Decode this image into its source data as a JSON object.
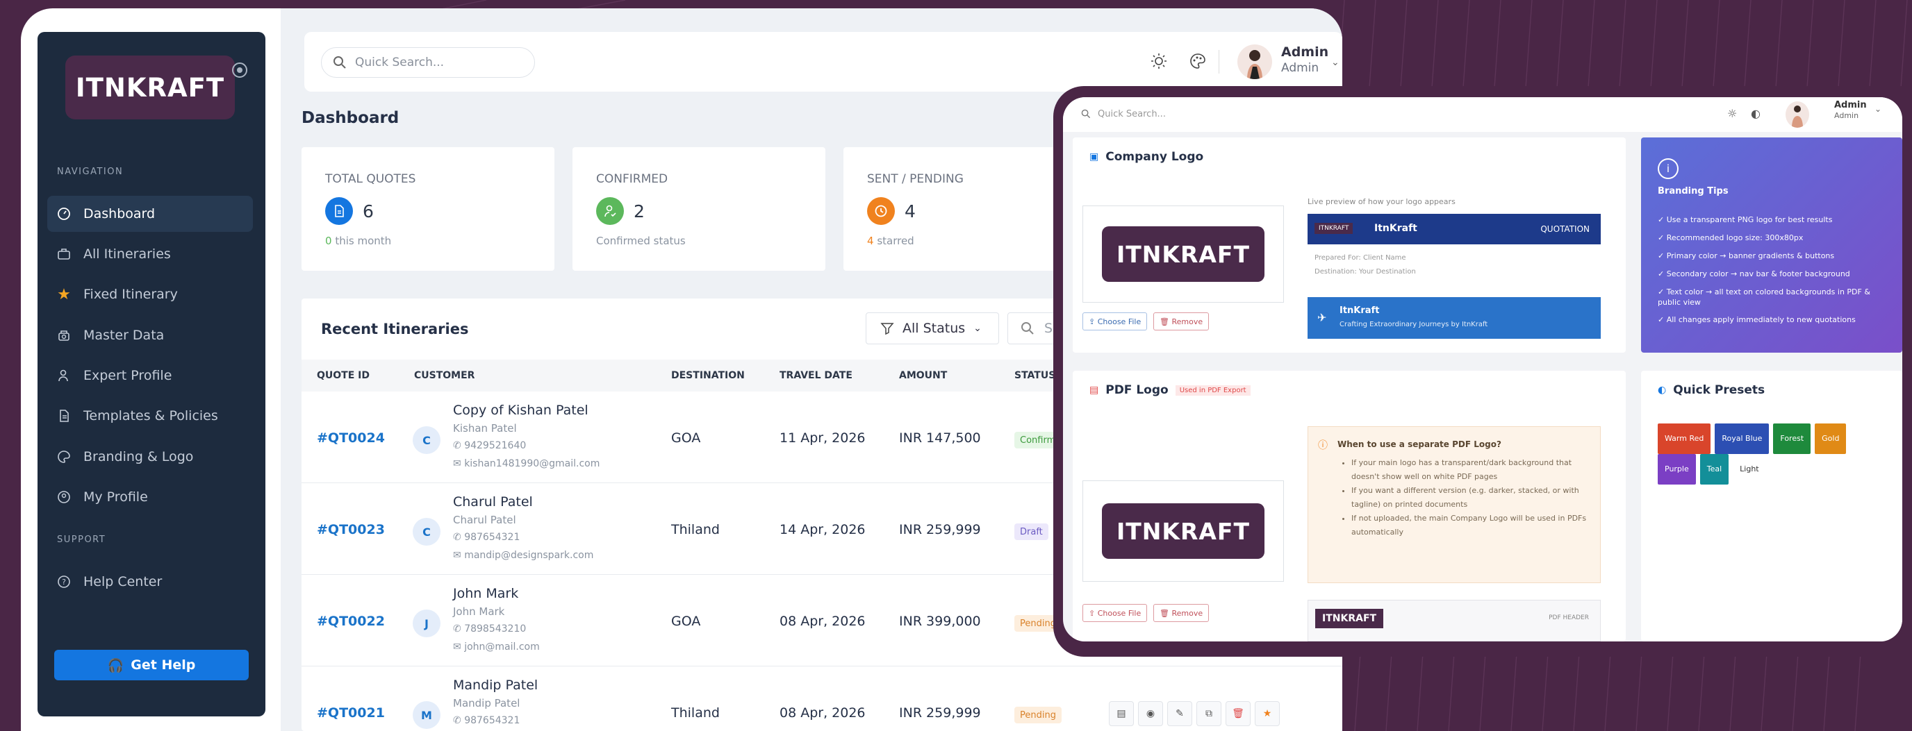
{
  "app": {
    "brand": "ITNKRAFT"
  },
  "sidebar": {
    "nav_heading": "NAVIGATION",
    "support_heading": "SUPPORT",
    "items": [
      {
        "label": "Dashboard",
        "icon": "dashboard-icon"
      },
      {
        "label": "All Itineraries",
        "icon": "briefcase-icon"
      },
      {
        "label": "Fixed Itinerary",
        "icon": "star-icon"
      },
      {
        "label": "Master Data",
        "icon": "database-icon"
      },
      {
        "label": "Expert Profile",
        "icon": "user-icon"
      },
      {
        "label": "Templates & Policies",
        "icon": "document-icon"
      },
      {
        "label": "Branding & Logo",
        "icon": "palette-icon"
      },
      {
        "label": "My Profile",
        "icon": "profile-icon"
      },
      {
        "label": "Help Center",
        "icon": "help-icon"
      }
    ],
    "get_help": "Get Help"
  },
  "topbar": {
    "search_placeholder": "Quick Search...",
    "user_name": "Admin",
    "user_role": "Admin"
  },
  "page": {
    "title": "Dashboard"
  },
  "stats": [
    {
      "label": "TOTAL QUOTES",
      "value": "6",
      "sub_num": "0",
      "sub_text": "this month",
      "color": "#1476e0"
    },
    {
      "label": "CONFIRMED",
      "value": "2",
      "sub_num": "",
      "sub_text": "Confirmed status",
      "color": "#5cb85c"
    },
    {
      "label": "SENT / PENDING",
      "value": "4",
      "sub_num": "4",
      "sub_text": "starred",
      "color": "#f0821e"
    }
  ],
  "recent": {
    "title": "Recent Itineraries",
    "filter": "All Status",
    "search_placeholder": "Search",
    "columns": [
      "QUOTE ID",
      "CUSTOMER",
      "DESTINATION",
      "TRAVEL DATE",
      "AMOUNT",
      "STATUS"
    ],
    "rows": [
      {
        "id": "#QT0024",
        "initial": "C",
        "name": "Copy of Kishan Patel",
        "sub": "Kishan Patel",
        "phone": "9429521640",
        "email": "kishan1481990@gmail.com",
        "dest": "GOA",
        "date": "11 Apr, 2026",
        "amount": "INR 147,500",
        "status": "Confirmed"
      },
      {
        "id": "#QT0023",
        "initial": "C",
        "name": "Charul Patel",
        "sub": "Charul Patel",
        "phone": "987654321",
        "email": "mandip@designspark.com",
        "dest": "Thiland",
        "date": "14 Apr, 2026",
        "amount": "INR 259,999",
        "status": "Draft"
      },
      {
        "id": "#QT0022",
        "initial": "J",
        "name": "John Mark",
        "sub": "John Mark",
        "phone": "7898543210",
        "email": "john@mail.com",
        "dest": "GOA",
        "date": "08 Apr, 2026",
        "amount": "INR 399,000",
        "status": "Pending"
      },
      {
        "id": "#QT0021",
        "initial": "M",
        "name": "Mandip Patel",
        "sub": "Mandip Patel",
        "phone": "987654321",
        "email": "",
        "dest": "Thiland",
        "date": "08 Apr, 2026",
        "amount": "INR 259,999",
        "status": "Pending"
      }
    ]
  },
  "branding": {
    "search_placeholder": "Quick Search...",
    "user_name": "Admin",
    "user_role": "Admin",
    "company_logo_title": "Company Logo",
    "preview_caption": "Live preview of how your logo appears",
    "preview_brand_small": "ITNKRAFT",
    "preview_brand": "ItnKraft",
    "preview_doc": "QUOTATION",
    "preview_line1": "Prepared For: Client Name",
    "preview_line2": "Destination: Your Destination",
    "footer_brand": "ItnKraft",
    "footer_tagline": "Crafting Extraordinary Journeys by ItnKraft",
    "choose_file": "Choose File",
    "remove": "Remove",
    "logo_text": "ITNKRAFT",
    "pdf_logo_title": "PDF Logo",
    "pdf_badge": "Used in PDF Export",
    "pdf_note_title": "When to use a separate PDF Logo?",
    "pdf_note_items": [
      "If your main logo has a transparent/dark background that doesn't show well on white PDF pages",
      "If you want a different version (e.g. darker, stacked, or with tagline) on printed documents",
      "If not uploaded, the main Company Logo will be used in PDFs automatically"
    ],
    "pdf_header_brand": "ITNKRAFT",
    "pdf_header_label": "PDF HEADER",
    "tips_title": "Branding Tips",
    "tips": [
      "Use a transparent PNG logo for best results",
      "Recommended logo size: 300x80px",
      "Primary color → banner gradients & buttons",
      "Secondary color → nav bar & footer background",
      "Text color → all text on colored backgrounds in PDF & public view",
      "All changes apply immediately to new quotations"
    ],
    "presets_title": "Quick Presets",
    "presets": [
      {
        "label": "Warm Red",
        "color": "#d9452b"
      },
      {
        "label": "Royal Blue",
        "color": "#2c4fb3"
      },
      {
        "label": "Forest",
        "color": "#1e8a3c"
      },
      {
        "label": "Gold",
        "color": "#e08a16"
      },
      {
        "label": "Purple",
        "color": "#7b3fc4"
      },
      {
        "label": "Teal",
        "color": "#138f99"
      },
      {
        "label": "Light",
        "color": "#ffffff"
      }
    ]
  }
}
